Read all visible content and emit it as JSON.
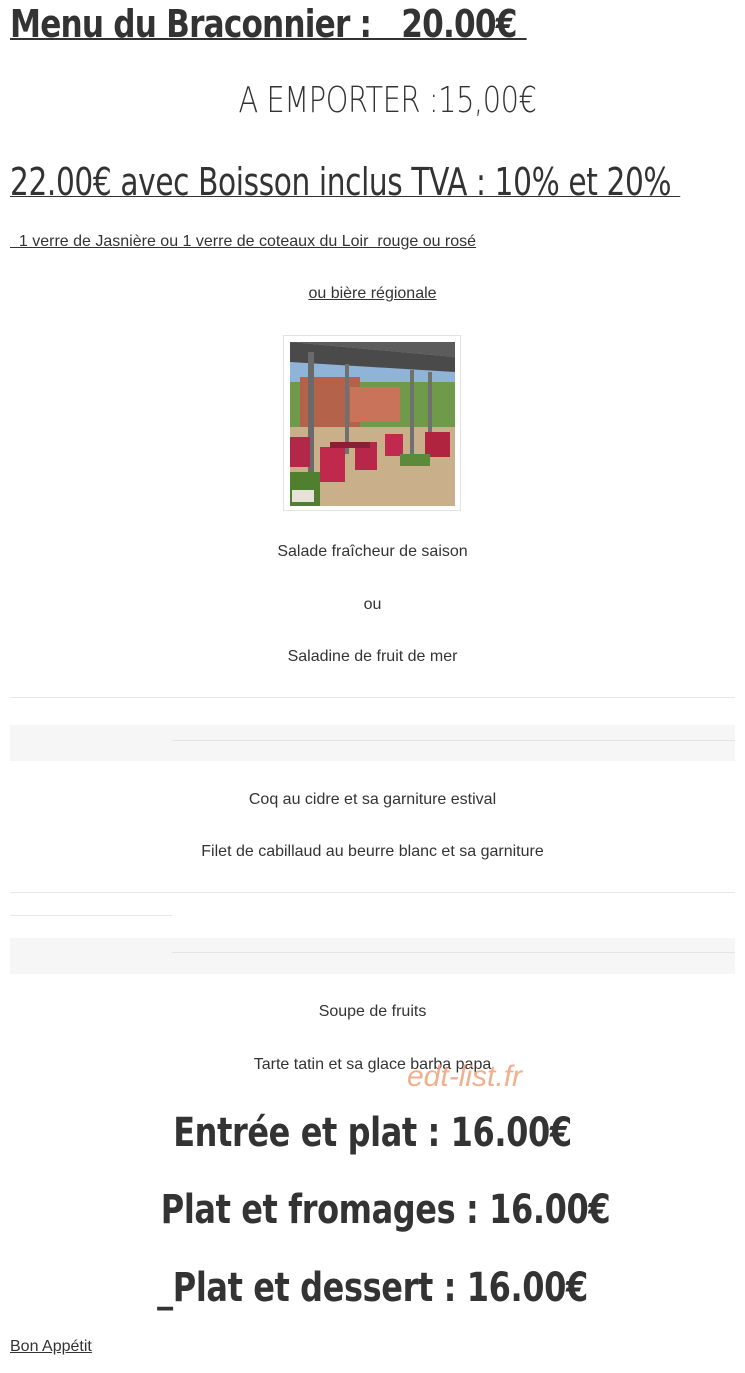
{
  "menu": {
    "title": "Menu du Braconnier :   20.00€ ",
    "emporter": "A EMPORTER :15,00€",
    "boisson_line": "22.00€ avec Boisson inclus TVA : 10% et 20% ",
    "verre_line": "  1 verre de Jasnière ou 1 verre de coteaux du Loir  rouge ou rosé",
    "biere_line": "ou bière régionale"
  },
  "entrees": {
    "item1": "Salade fraîcheur de saison",
    "or": "ou",
    "item2": "Saladine de fruit de mer"
  },
  "plats": {
    "item1": "Coq au cidre et sa garniture estival",
    "item2": "Filet de cabillaud au beurre blanc et sa garniture"
  },
  "desserts": {
    "item1": "Soupe de fruits",
    "item2": "Tarte tatin et sa glace barba papa"
  },
  "watermark": "edt-list.fr",
  "formules": {
    "entree_plat": "Entrée et plat : 16.00€",
    "plat_fromages": "Plat et fromages : 16.00€",
    "plat_dessert": "_Plat et dessert : 16.00€"
  },
  "footer": {
    "bon_appetit": "Bon Appétit"
  }
}
